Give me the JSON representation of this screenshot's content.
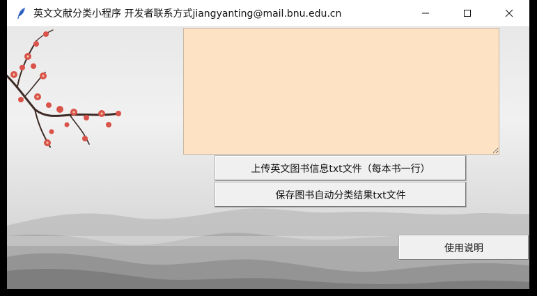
{
  "window": {
    "title": "英文文献分类小程序 开发者联系方式jiangyanting@mail.bnu.edu.cn",
    "app_icon": "feather-icon",
    "controls": [
      "minimize-icon",
      "maximize-icon",
      "close-icon"
    ]
  },
  "main": {
    "text_area_value": "",
    "text_area_bg": "#fde2c4",
    "upload_button_label": "上传英文图书信息txt文件（每本书一行）",
    "save_button_label": "保存图书自动分类结果txt文件",
    "help_button_label": "使用说明"
  },
  "background": {
    "image": "plum-blossom-ink-mountains"
  }
}
